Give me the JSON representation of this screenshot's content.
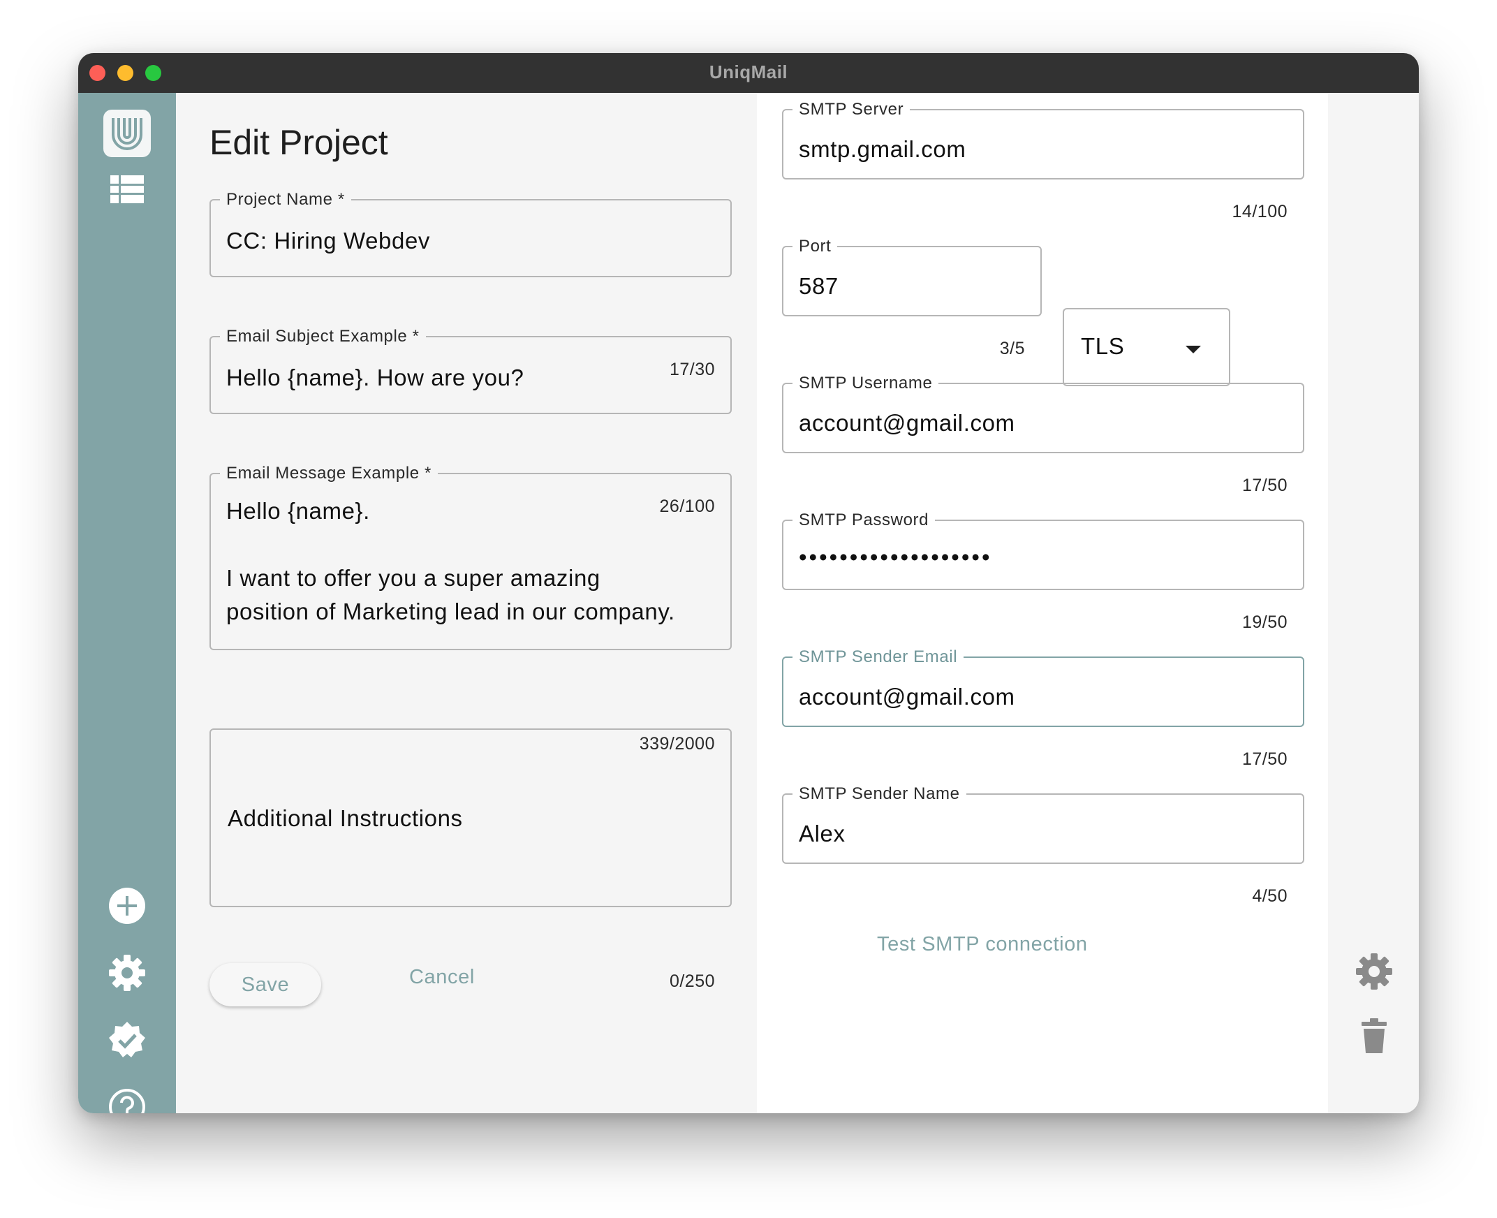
{
  "window": {
    "title": "UniqMail"
  },
  "page": {
    "title": "Edit Project"
  },
  "sidebar": {
    "icons": [
      "logo",
      "projects-list-icon",
      "add-icon",
      "settings-icon",
      "verified-icon",
      "help-icon"
    ]
  },
  "form": {
    "project_name": {
      "label": "Project Name *",
      "value": "CC: Hiring Webdev",
      "counter": "17/30"
    },
    "email_subject": {
      "label": "Email Subject Example *",
      "value": "Hello {name}. How are you?",
      "counter": "26/100"
    },
    "email_message": {
      "label": "Email Message Example *",
      "line1": "Hello {name}.",
      "line2": "I want to offer you a super amazing",
      "line3": "position of Marketing lead in our company.",
      "counter": "339/2000"
    },
    "additional_instructions": {
      "placeholder": "Additional Instructions",
      "counter": "0/250"
    },
    "save_label": "Save",
    "cancel_label": "Cancel"
  },
  "smtp": {
    "server": {
      "label": "SMTP Server",
      "value": "smtp.gmail.com",
      "counter": "14/100"
    },
    "port": {
      "label": "Port",
      "value": "587",
      "counter": "3/5"
    },
    "security": {
      "value": "TLS"
    },
    "username": {
      "label": "SMTP Username",
      "value": "account@gmail.com",
      "counter": "17/50"
    },
    "password": {
      "label": "SMTP Password",
      "value": "•••••••••••••••••••",
      "counter": "19/50"
    },
    "sender_email": {
      "label": "SMTP Sender Email",
      "value": "account@gmail.com",
      "counter": "17/50"
    },
    "sender_name": {
      "label": "SMTP Sender Name",
      "value": "Alex",
      "counter": "4/50"
    },
    "test_label": "Test SMTP connection"
  },
  "colors": {
    "accent": "#82a4a6",
    "titlebar": "#323232"
  }
}
